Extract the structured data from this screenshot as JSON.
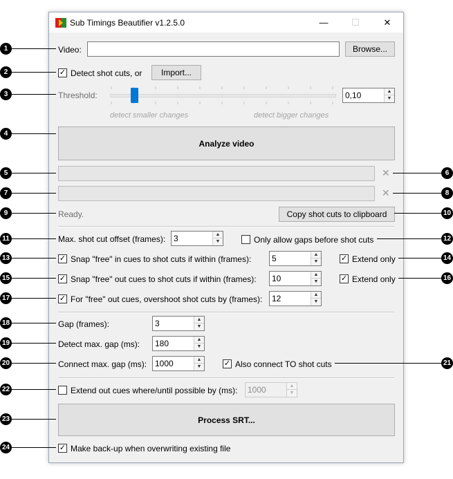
{
  "window": {
    "title": "Sub Timings Beautifier v1.2.5.0",
    "minimize": "—",
    "maximize": "☐",
    "close": "✕"
  },
  "video": {
    "label": "Video:",
    "value": "",
    "browse_label": "Browse..."
  },
  "detect": {
    "label": "Detect shot cuts, or",
    "checked": true,
    "import_label": "Import..."
  },
  "threshold": {
    "label": "Threshold:",
    "value": "0,10",
    "slider_level": 0.1,
    "hint_left": "detect smaller changes",
    "hint_right": "detect bigger changes"
  },
  "analyze_label": "Analyze video",
  "progress_1": {
    "clear": "✕"
  },
  "progress_2": {
    "clear": "✕"
  },
  "status": "Ready.",
  "copy_label": "Copy shot cuts to clipboard",
  "max_offset": {
    "label": "Max. shot cut offset (frames):",
    "value": "3"
  },
  "only_gaps": {
    "label": "Only allow gaps before shot cuts",
    "checked": false
  },
  "snap_in": {
    "label": "Snap \"free\" in cues to shot cuts if within (frames):",
    "checked": true,
    "value": "5",
    "extend_label": "Extend only",
    "extend_checked": true
  },
  "snap_out": {
    "label": "Snap \"free\" out cues to shot cuts if within (frames):",
    "checked": true,
    "value": "10",
    "extend_label": "Extend only",
    "extend_checked": true
  },
  "overshoot": {
    "label": "For \"free\" out cues, overshoot shot cuts by (frames):",
    "checked": true,
    "value": "12"
  },
  "gap": {
    "label": "Gap (frames):",
    "value": "3"
  },
  "detect_gap": {
    "label": "Detect max. gap (ms):",
    "value": "180"
  },
  "connect_gap": {
    "label": "Connect max. gap (ms):",
    "value": "1000",
    "also_label": "Also connect TO shot cuts",
    "also_checked": true
  },
  "extend_out": {
    "label": "Extend out cues where/until possible by (ms):",
    "checked": false,
    "value": "1000"
  },
  "process_label": "Process SRT...",
  "backup": {
    "label": "Make back-up when overwriting existing file",
    "checked": true
  },
  "markers": [
    "1",
    "2",
    "3",
    "4",
    "5",
    "6",
    "7",
    "8",
    "9",
    "10",
    "11",
    "12",
    "13",
    "14",
    "15",
    "16",
    "17",
    "18",
    "19",
    "20",
    "21",
    "22",
    "23",
    "24"
  ],
  "colors": {
    "accent": "#0078d7",
    "window_bg": "#f0f0f0",
    "app_icon_red": "#e01b1b",
    "app_icon_yellow": "#f2c300"
  }
}
